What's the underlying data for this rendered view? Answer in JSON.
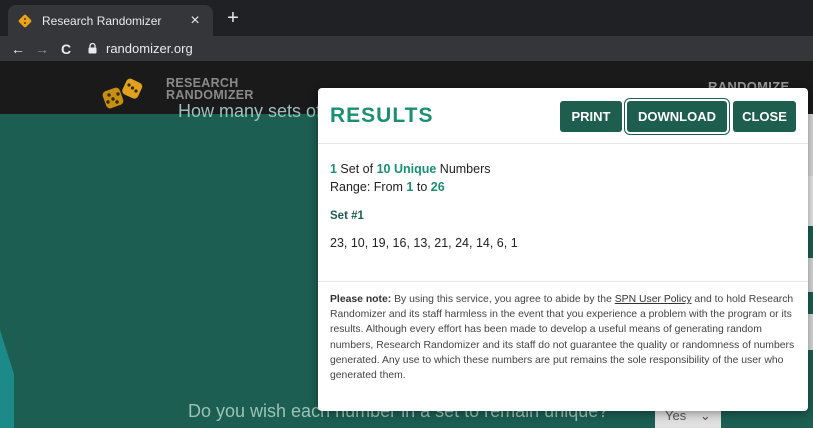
{
  "browser": {
    "tab_title": "Research Randomizer",
    "tab_close": "×",
    "new_tab": "+",
    "back": "←",
    "forward": "→",
    "reload": "C",
    "url": "randomizer.org"
  },
  "site": {
    "logo_line1": "RESEARCH",
    "logo_line2": "RANDOMIZER",
    "nav_item": "RANDOMIZE",
    "bg_question_1": "How many sets of numbers do you want to generate?",
    "bg_question_2": "Do you wish each number in a set to remain unique?",
    "bg_select_value": "Yes",
    "bg_select_chevron": "⌄"
  },
  "modal": {
    "title": "RESULTS",
    "buttons": {
      "print": "PRINT",
      "download": "DOWNLOAD",
      "close": "CLOSE"
    },
    "summary": {
      "count": "1",
      "count_suffix": " Set of ",
      "amount": "10 Unique",
      "amount_suffix": " Numbers"
    },
    "range": {
      "prefix": "Range: From ",
      "from": "1",
      "middle": " to ",
      "to": "26"
    },
    "set_label": "Set #1",
    "numbers": "23, 10, 19, 16, 13, 21, 24, 14, 6, 1",
    "note": {
      "label": "Please note:",
      "text_before_link": " By using this service, you agree to abide by the ",
      "link": "SPN User Policy",
      "text_after_link": " and to hold Research Randomizer and its staff harmless in the event that you experience a problem with the program or its results. Although every effort has been made to develop a useful means of generating random numbers, Research Randomizer and its staff do not guarantee the quality or randomness of numbers generated. Any use to which these numbers are put remains the sole responsibility of the user who generated them."
    }
  },
  "colors": {
    "accent": "#1a8f74",
    "button": "#1d5e4e",
    "site_background": "#1c5e52",
    "header": "#1a1a1a"
  }
}
